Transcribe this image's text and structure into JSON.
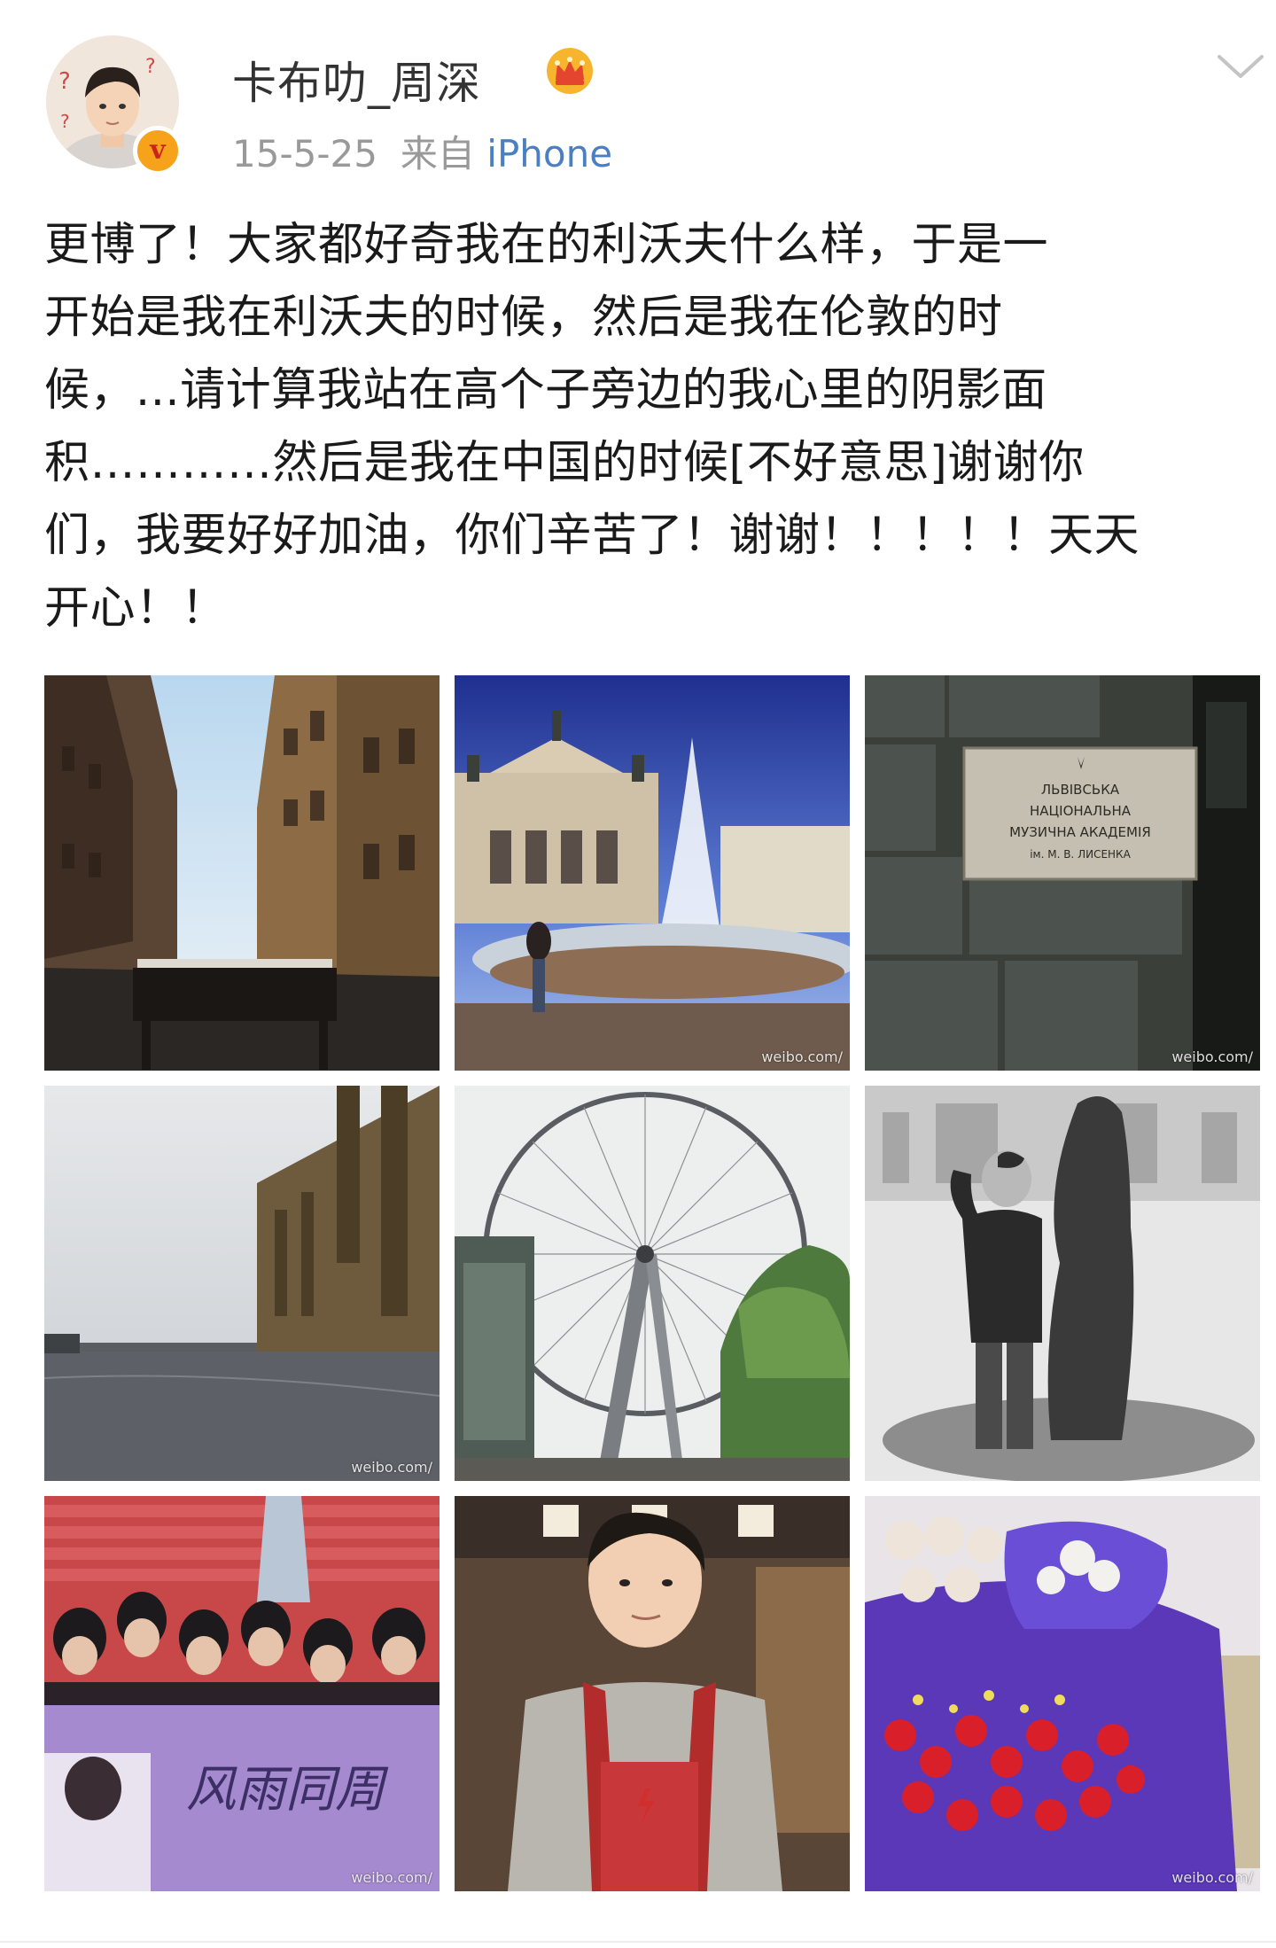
{
  "user": {
    "name": "卡布叻_周深",
    "date": "15-5-25",
    "from_label": "来自",
    "source": "iPhone",
    "verified_badge": "v"
  },
  "post": {
    "lines": [
      "更博了！大家都好奇我在的利沃夫什么样，于是一",
      "开始是我在利沃夫的时候，然后是我在伦敦的时",
      "候，...请计算我站在高个子旁边的我心里的阴影面",
      "积…………然后是我在中国的时候[不好意思]谢谢你",
      "们，我要好好加油，你们辛苦了！谢谢！！！！！天天",
      "开心！！"
    ]
  },
  "photos": [
    {
      "subject": "lviv-street"
    },
    {
      "subject": "lviv-opera-fountain"
    },
    {
      "subject": "music-academy-plaque",
      "plaque": [
        "ЛЬВІВСЬКА",
        "НАЦІОНАЛЬНА",
        "МУЗИЧНА АКАДЕМІЯ",
        "ім. М. В. ЛИСЕНКА"
      ]
    },
    {
      "subject": "london-thames"
    },
    {
      "subject": "london-eye"
    },
    {
      "subject": "sketch-statue"
    },
    {
      "subject": "concert-hall-fans",
      "banner": "风雨同周"
    },
    {
      "subject": "selfie-apron"
    },
    {
      "subject": "flower-bouquet"
    }
  ],
  "watermark": "weibo.com/",
  "icons": {
    "crown": "crown-icon",
    "chevron": "chevron-down-icon"
  },
  "colors": {
    "link_blue": "#4a7fc1",
    "meta_gray": "#999999",
    "badge_orange": "#f7a21b"
  }
}
